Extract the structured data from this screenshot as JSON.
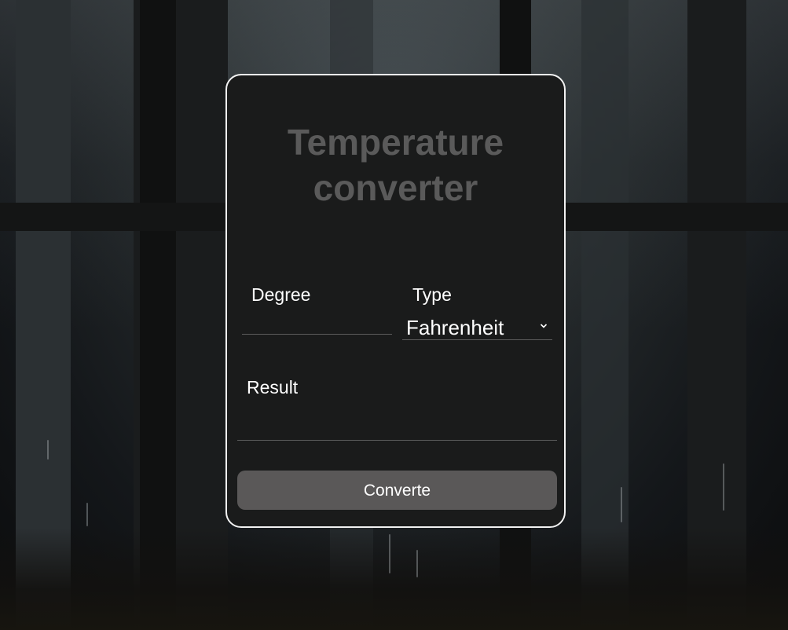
{
  "converter": {
    "title_line1": "Temperature",
    "title_line2": "converter",
    "degree_label": "Degree",
    "degree_value": "",
    "type_label": "Type",
    "type_selected": "Fahrenheit",
    "result_label": "Result",
    "result_value": "",
    "convert_button": "Converte"
  },
  "colors": {
    "card_background": "#1a1b1b",
    "card_border": "#f2f2f2",
    "title": "#5a5a5a",
    "button": "#5a5858",
    "text": "#ffffff"
  },
  "icons": {
    "dropdown": "chevron-down-icon"
  }
}
